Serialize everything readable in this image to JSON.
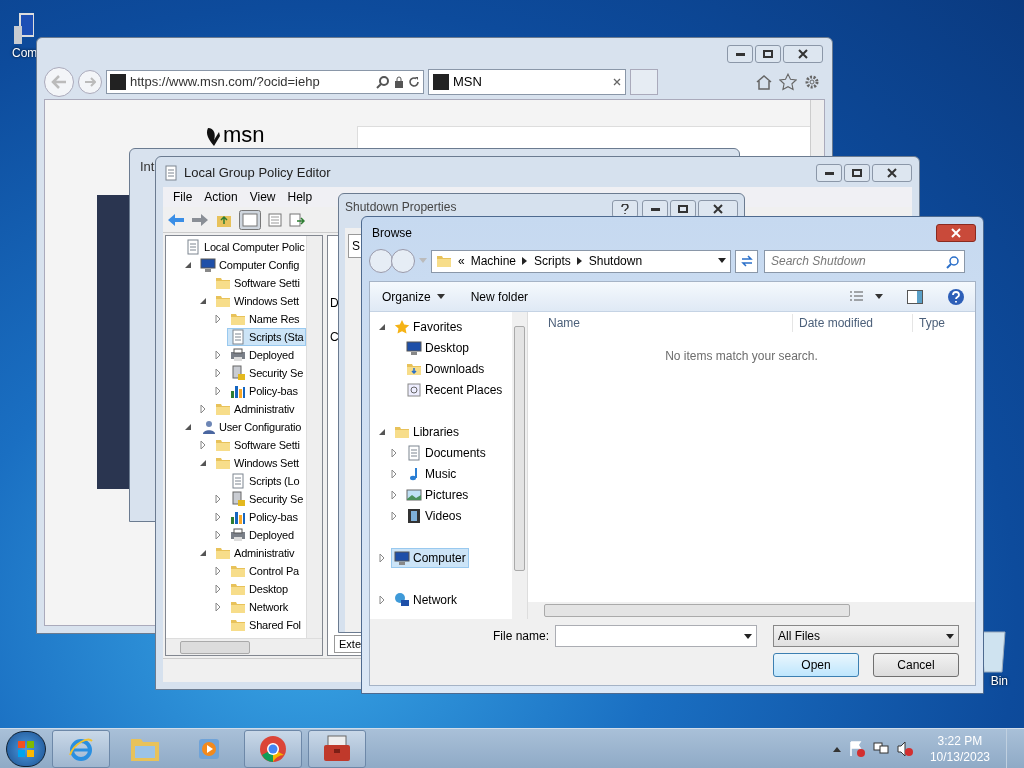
{
  "desktop_icons": [
    {
      "label": "Com",
      "kind": "computer"
    },
    {
      "label": "Bin",
      "kind": "bin"
    }
  ],
  "browser": {
    "address": "https://www.msn.com/?ocid=iehp",
    "tab": "MSN",
    "logo": "msn"
  },
  "back_dialog": {
    "title": "Int"
  },
  "gpedit": {
    "title": "Local Group Policy Editor",
    "menu": [
      "File",
      "Action",
      "View",
      "Help"
    ],
    "tree": [
      {
        "label": "Local Computer Polic",
        "kind": "policy",
        "selected": false,
        "children": [
          {
            "label": "Computer Config",
            "kind": "computer",
            "expanded": true,
            "selected": false,
            "children": [
              {
                "label": "Software Setti",
                "kind": "folder",
                "selected": false
              },
              {
                "label": "Windows Sett",
                "kind": "folder",
                "expanded": true,
                "selected": false,
                "children": [
                  {
                    "label": "Name Res",
                    "kind": "folder",
                    "expanded": false,
                    "selected": false
                  },
                  {
                    "label": "Scripts (Sta",
                    "kind": "script",
                    "selected": true
                  },
                  {
                    "label": "Deployed",
                    "kind": "printer",
                    "expanded": false,
                    "selected": false
                  },
                  {
                    "label": "Security Se",
                    "kind": "security",
                    "expanded": false,
                    "selected": false
                  },
                  {
                    "label": "Policy-bas",
                    "kind": "chart",
                    "expanded": false,
                    "selected": false
                  }
                ]
              },
              {
                "label": "Administrativ",
                "kind": "folder",
                "expanded": false,
                "selected": false
              }
            ]
          },
          {
            "label": "User Configuratio",
            "kind": "user",
            "expanded": true,
            "selected": false,
            "children": [
              {
                "label": "Software Setti",
                "kind": "folder",
                "expanded": false,
                "selected": false
              },
              {
                "label": "Windows Sett",
                "kind": "folder",
                "expanded": true,
                "selected": false,
                "children": [
                  {
                    "label": "Scripts (Lo",
                    "kind": "script",
                    "selected": false
                  },
                  {
                    "label": "Security Se",
                    "kind": "security",
                    "expanded": false,
                    "selected": false
                  },
                  {
                    "label": "Policy-bas",
                    "kind": "chart",
                    "expanded": false,
                    "selected": false
                  },
                  {
                    "label": "Deployed",
                    "kind": "printer",
                    "expanded": false,
                    "selected": false
                  }
                ]
              },
              {
                "label": "Administrativ",
                "kind": "folder",
                "expanded": true,
                "selected": false,
                "children": [
                  {
                    "label": "Control Pa",
                    "kind": "folder",
                    "expanded": false,
                    "selected": false
                  },
                  {
                    "label": "Desktop",
                    "kind": "folder",
                    "expanded": false,
                    "selected": false
                  },
                  {
                    "label": "Network",
                    "kind": "folder",
                    "expanded": false,
                    "selected": false
                  },
                  {
                    "label": "Shared Fol",
                    "kind": "folder",
                    "selected": false
                  }
                ]
              }
            ]
          }
        ]
      }
    ],
    "pane_fragments": [
      "D",
      "C"
    ],
    "bottom_tab": "Exte"
  },
  "properties": {
    "title": "Shutdown Properties",
    "tab_fragment": "S"
  },
  "browse": {
    "title": "Browse",
    "path_overflow": "«",
    "path": [
      "Machine",
      "Scripts",
      "Shutdown"
    ],
    "search_placeholder": "Search Shutdown",
    "toolbar": [
      "Organize",
      "New folder"
    ],
    "nav": [
      {
        "label": "Favorites",
        "kind": "star",
        "expanded": true,
        "selected": false,
        "children": [
          {
            "label": "Desktop",
            "kind": "desktop",
            "selected": false
          },
          {
            "label": "Downloads",
            "kind": "downloads",
            "selected": false
          },
          {
            "label": "Recent Places",
            "kind": "recent",
            "selected": false
          }
        ]
      },
      {
        "label": "Libraries",
        "kind": "library",
        "expanded": true,
        "selected": false,
        "children": [
          {
            "label": "Documents",
            "kind": "document",
            "expanded": false,
            "selected": false
          },
          {
            "label": "Music",
            "kind": "music",
            "expanded": false,
            "selected": false
          },
          {
            "label": "Pictures",
            "kind": "picture",
            "expanded": false,
            "selected": false
          },
          {
            "label": "Videos",
            "kind": "video",
            "expanded": false,
            "selected": false
          }
        ]
      },
      {
        "label": "Computer",
        "kind": "computer",
        "expanded": false,
        "selected": true
      },
      {
        "label": "Network",
        "kind": "network",
        "expanded": false,
        "selected": false
      }
    ],
    "columns": [
      "Name",
      "Date modified",
      "Type"
    ],
    "empty_message": "No items match your search.",
    "file_name_label": "File name:",
    "filter": "All Files",
    "buttons": [
      "Open",
      "Cancel"
    ]
  },
  "taskbar": {
    "items": [
      {
        "kind": "ie",
        "active": true
      },
      {
        "kind": "explorer",
        "active": false
      },
      {
        "kind": "media",
        "active": false
      },
      {
        "kind": "chrome",
        "active": true
      },
      {
        "kind": "toolbox",
        "active": true
      }
    ],
    "time": "3:22 PM",
    "date": "10/13/2023"
  }
}
